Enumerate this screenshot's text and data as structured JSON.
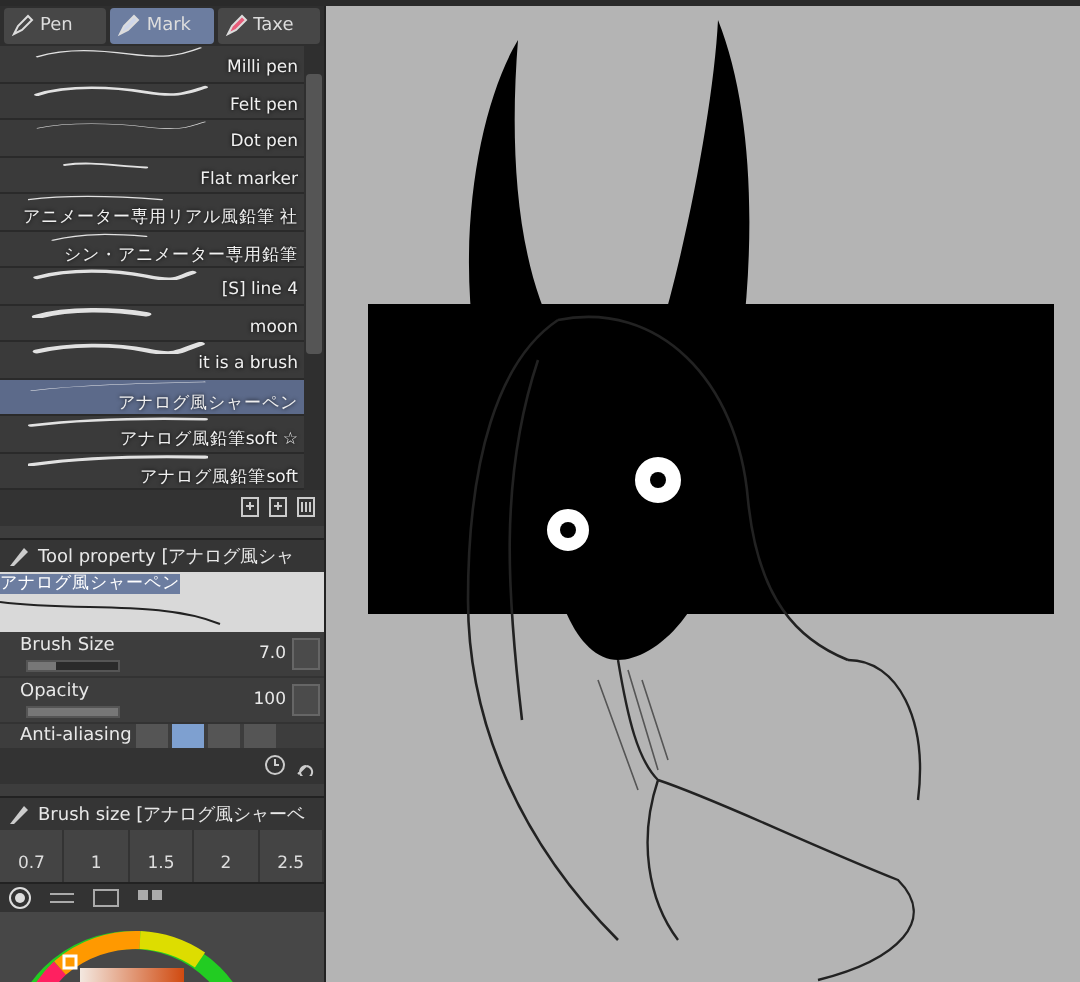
{
  "tool_tabs": [
    {
      "label": "Pen",
      "selected": false
    },
    {
      "label": "Mark",
      "selected": true
    },
    {
      "label": "Taxe",
      "selected": false
    }
  ],
  "brushes": [
    {
      "name": "Milli pen",
      "selected": false
    },
    {
      "name": "Felt pen",
      "selected": false
    },
    {
      "name": "Dot pen",
      "selected": false
    },
    {
      "name": "Flat marker",
      "selected": false
    },
    {
      "name": "アニメーター専用リアル風鉛筆 社",
      "selected": false
    },
    {
      "name": "シン・アニメーター専用鉛筆",
      "selected": false
    },
    {
      "name": "[S] line 4",
      "selected": false
    },
    {
      "name": "moon",
      "selected": false
    },
    {
      "name": "it is a brush",
      "selected": false
    },
    {
      "name": "アナログ風シャーペン",
      "selected": true
    },
    {
      "name": "アナログ風鉛筆soft ☆",
      "selected": false
    },
    {
      "name": "アナログ風鉛筆soft",
      "selected": false
    }
  ],
  "tool_property": {
    "title": "Tool property [アナログ風シャ",
    "preset": "アナログ風シャーペン",
    "settings": [
      {
        "label": "Brush Size",
        "value": "7.0",
        "level": 0.3
      },
      {
        "label": "Opacity",
        "value": "100",
        "level": 1
      }
    ],
    "anti_aliasing": {
      "label": "Anti-aliasing",
      "options": [
        {
          "selected": false
        },
        {
          "selected": true
        },
        {
          "selected": false
        },
        {
          "selected": false
        }
      ]
    }
  },
  "brush_size": {
    "title": "Brush size [アナログ風シャーベ",
    "sizes": [
      "0.7",
      "1",
      "1.5",
      "2",
      "2.5"
    ]
  }
}
